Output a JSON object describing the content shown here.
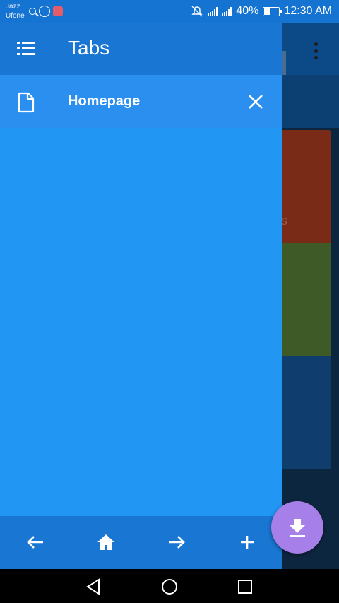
{
  "status_bar": {
    "carrier_1": "Jazz",
    "carrier_2": "Ufone",
    "battery_text": "40%",
    "battery_level": 0.4,
    "time": "12:30 AM",
    "icons": [
      "search-icon",
      "whatsapp-icon",
      "app-notification-icon",
      "mute-icon",
      "signal-icon",
      "battery-icon"
    ]
  },
  "drawer": {
    "title": "Tabs",
    "menu_icon": "list-icon",
    "tabs": [
      {
        "label": "Homepage",
        "icon": "page-icon",
        "close_icon": "close-icon"
      }
    ],
    "bottom_bar": {
      "buttons": [
        "back-arrow-icon",
        "home-icon",
        "forward-arrow-icon",
        "plus-icon"
      ]
    }
  },
  "fab": {
    "icon": "download-icon",
    "color": "#a77fe8"
  },
  "nav_bar": {
    "buttons": [
      "back-triangle-icon",
      "home-circle-icon",
      "recents-square-icon"
    ]
  },
  "background": {
    "card_colors": [
      "#7a2b17",
      "#3e5a26",
      "#0f3e6e"
    ],
    "visible_fragment": "s"
  },
  "colors": {
    "drawer_header": "#1976d2",
    "drawer_body": "#2196f3",
    "status_bar": "#1573d2"
  }
}
